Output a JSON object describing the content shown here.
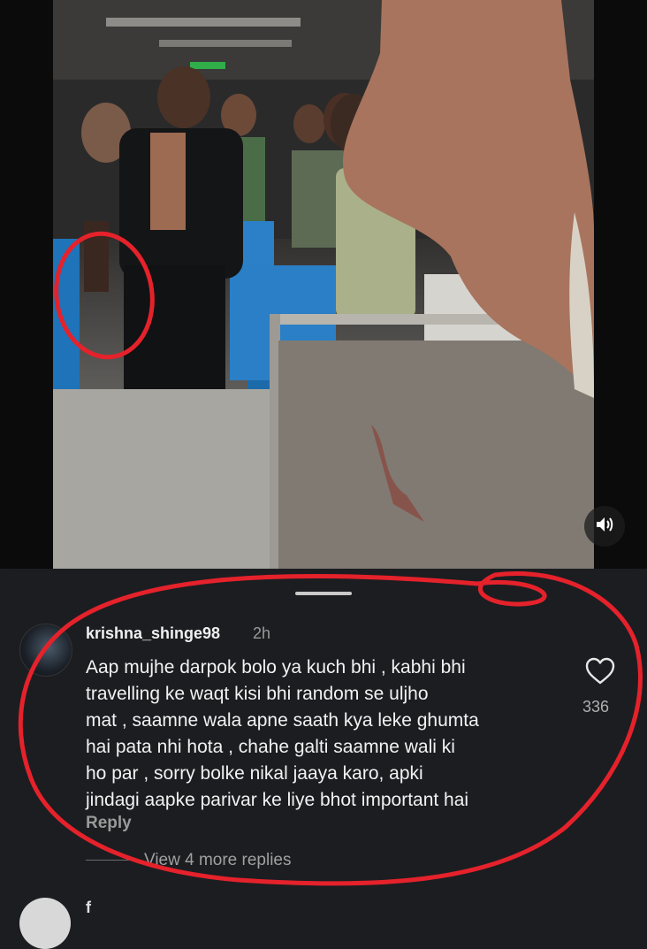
{
  "video": {
    "mute_icon": "speaker-muted-icon"
  },
  "comment": {
    "username": "krishna_shinge98",
    "time": "2h",
    "text": "Aap mujhe darpok bolo ya kuch bhi , kabhi bhi\ntravelling ke waqt kisi bhi random se uljho\nmat , saamne wala apne saath kya leke ghumta\nhai pata nhi hota , chahe galti saamne wali ki\nho par , sorry bolke nikal jaaya karo, apki\njindagi aapke parivar ke liye bhot important hai",
    "reply_label": "Reply",
    "like_count": "336",
    "like_icon": "heart-icon",
    "view_replies": "View 4 more replies"
  },
  "next_comment": {
    "username": "f"
  },
  "colors": {
    "annotation": "#e5222b",
    "sheet": "#1c1d21"
  }
}
